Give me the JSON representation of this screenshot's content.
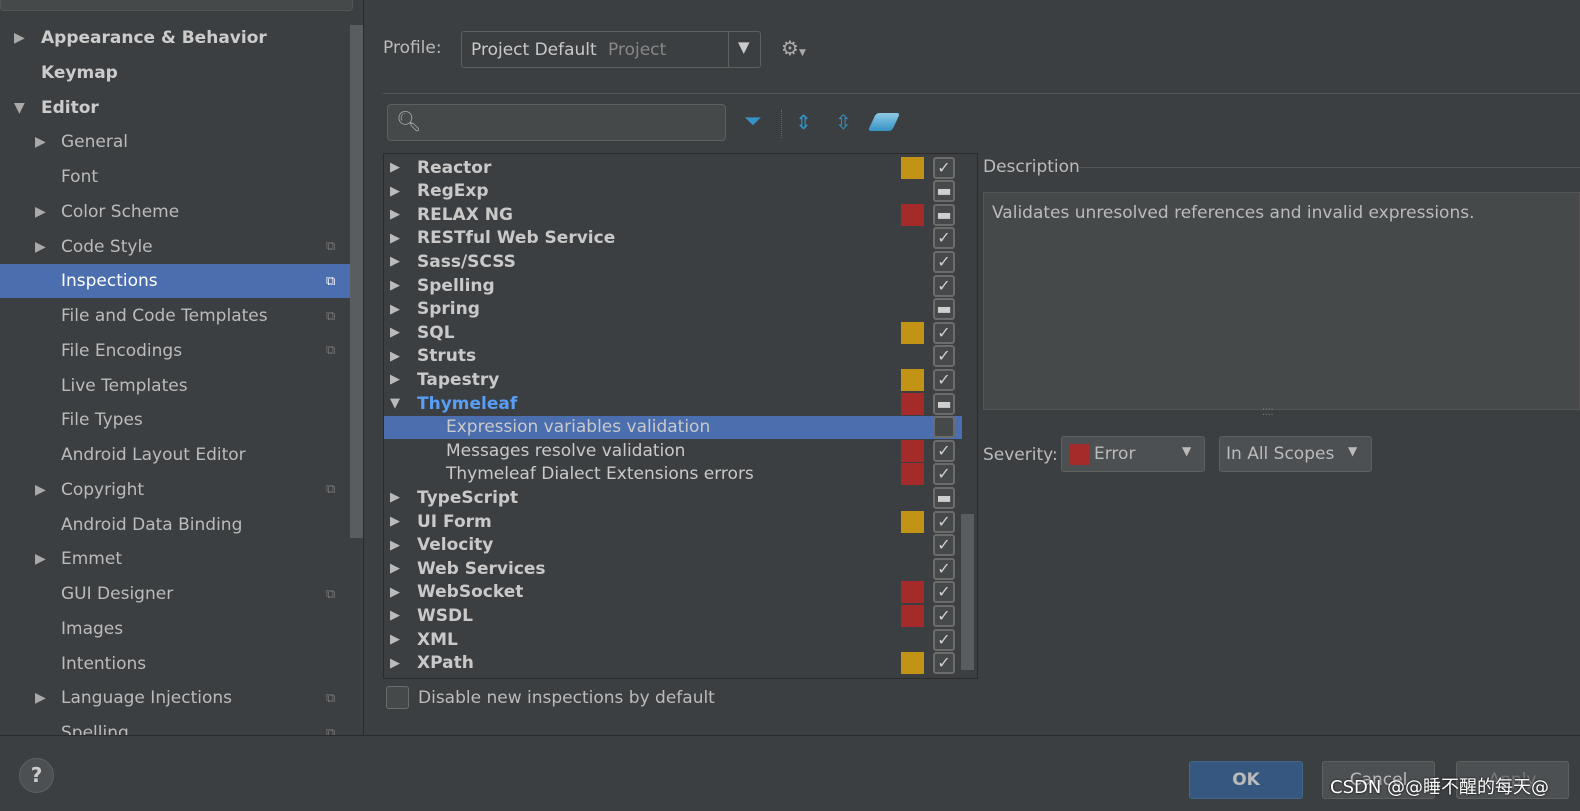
{
  "sidebar": {
    "items": [
      {
        "label": "Appearance & Behavior",
        "level": 0,
        "expander": "collapsed",
        "bold": true
      },
      {
        "label": "Keymap",
        "level": 0,
        "bold": true
      },
      {
        "label": "Editor",
        "level": 0,
        "expander": "expanded",
        "bold": true
      },
      {
        "label": "General",
        "level": 1,
        "expander": "collapsed"
      },
      {
        "label": "Font",
        "level": 1
      },
      {
        "label": "Color Scheme",
        "level": 1,
        "expander": "collapsed"
      },
      {
        "label": "Code Style",
        "level": 1,
        "expander": "collapsed",
        "copy": true
      },
      {
        "label": "Inspections",
        "level": 1,
        "copy": true,
        "selected": true
      },
      {
        "label": "File and Code Templates",
        "level": 1,
        "copy": true
      },
      {
        "label": "File Encodings",
        "level": 1,
        "copy": true
      },
      {
        "label": "Live Templates",
        "level": 1
      },
      {
        "label": "File Types",
        "level": 1
      },
      {
        "label": "Android Layout Editor",
        "level": 1
      },
      {
        "label": "Copyright",
        "level": 1,
        "expander": "collapsed",
        "copy": true
      },
      {
        "label": "Android Data Binding",
        "level": 1
      },
      {
        "label": "Emmet",
        "level": 1,
        "expander": "collapsed"
      },
      {
        "label": "GUI Designer",
        "level": 1,
        "copy": true
      },
      {
        "label": "Images",
        "level": 1
      },
      {
        "label": "Intentions",
        "level": 1
      },
      {
        "label": "Language Injections",
        "level": 1,
        "expander": "collapsed",
        "copy": true
      },
      {
        "label": "Spelling",
        "level": 1,
        "copy": true
      }
    ]
  },
  "profile": {
    "label": "Profile:",
    "value": "Project Default",
    "scope": "Project"
  },
  "colors": {
    "error": "#a52a2a",
    "warning": "#c39315",
    "selection": "#4b6eaf",
    "accent": "#589df6"
  },
  "tree": {
    "rows": [
      {
        "label": "Reactor",
        "severity": "warning",
        "state": "checked",
        "expander": "collapsed"
      },
      {
        "label": "RegExp",
        "state": "mixed",
        "expander": "collapsed"
      },
      {
        "label": "RELAX NG",
        "severity": "error",
        "state": "mixed",
        "expander": "collapsed"
      },
      {
        "label": "RESTful Web Service",
        "state": "checked",
        "expander": "collapsed"
      },
      {
        "label": "Sass/SCSS",
        "state": "checked",
        "expander": "collapsed"
      },
      {
        "label": "Spelling",
        "state": "checked",
        "expander": "collapsed"
      },
      {
        "label": "Spring",
        "state": "mixed",
        "expander": "collapsed"
      },
      {
        "label": "SQL",
        "severity": "warning",
        "state": "checked",
        "expander": "collapsed"
      },
      {
        "label": "Struts",
        "state": "checked",
        "expander": "collapsed"
      },
      {
        "label": "Tapestry",
        "severity": "warning",
        "state": "checked",
        "expander": "collapsed"
      },
      {
        "label": "Thymeleaf",
        "severity": "error",
        "state": "mixed",
        "expander": "expanded",
        "highlight": true
      },
      {
        "label": "Expression variables validation",
        "state": "unchecked",
        "child": true,
        "selected": true
      },
      {
        "label": "Messages resolve validation",
        "severity": "error",
        "state": "checked",
        "child": true
      },
      {
        "label": "Thymeleaf Dialect Extensions errors",
        "severity": "error",
        "state": "checked",
        "child": true
      },
      {
        "label": "TypeScript",
        "state": "mixed",
        "expander": "collapsed"
      },
      {
        "label": "UI Form",
        "severity": "warning",
        "state": "checked",
        "expander": "collapsed"
      },
      {
        "label": "Velocity",
        "state": "checked",
        "expander": "collapsed"
      },
      {
        "label": "Web Services",
        "state": "checked",
        "expander": "collapsed"
      },
      {
        "label": "WebSocket",
        "severity": "error",
        "state": "checked",
        "expander": "collapsed"
      },
      {
        "label": "WSDL",
        "severity": "error",
        "state": "checked",
        "expander": "collapsed"
      },
      {
        "label": "XML",
        "state": "checked",
        "expander": "collapsed"
      },
      {
        "label": "XPath",
        "severity": "warning",
        "state": "checked",
        "expander": "collapsed"
      }
    ]
  },
  "description": {
    "title": "Description",
    "text": "Validates unresolved references and invalid expressions."
  },
  "severity": {
    "label": "Severity:",
    "value": "Error",
    "scope": "In All Scopes"
  },
  "disable_new": {
    "label": "Disable new inspections by default",
    "checked": false
  },
  "buttons": {
    "ok": "OK",
    "cancel": "Cancel",
    "apply": "Apply",
    "help": "?"
  },
  "watermark": "CSDN @@睡不醒的每天@"
}
